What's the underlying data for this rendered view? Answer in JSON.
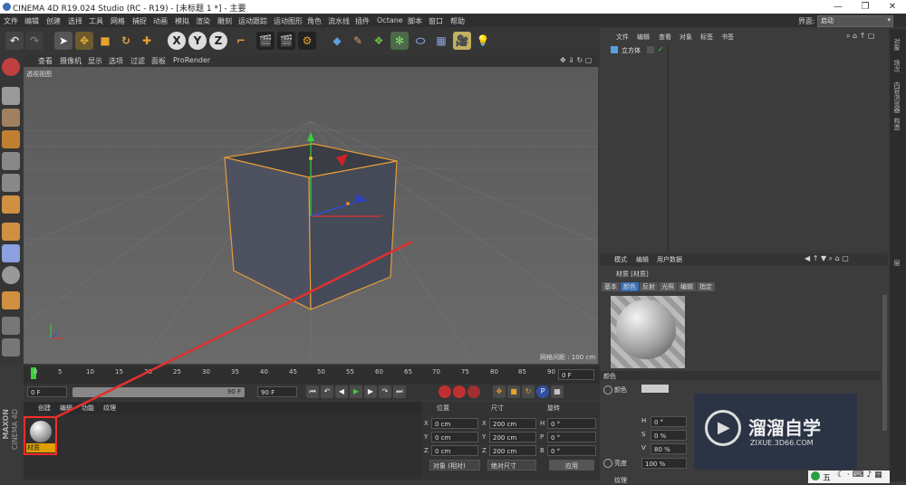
{
  "titlebar": {
    "title": "CINEMA 4D R19.024 Studio (RC - R19) - [未标题 1 *] - 主要",
    "min": "—",
    "max": "❐",
    "close": "✕"
  },
  "menu": [
    "文件",
    "编辑",
    "创建",
    "选择",
    "工具",
    "网格",
    "捕捉",
    "动画",
    "模拟",
    "渲染",
    "雕刻",
    "运动跟踪",
    "运动图形",
    "角色",
    "流水线",
    "插件",
    "Octane",
    "脚本",
    "窗口",
    "帮助"
  ],
  "interface": {
    "label": "界面:",
    "value": "启动"
  },
  "toolbar": {
    "x": "X",
    "y": "Y",
    "z": "Z"
  },
  "viewport": {
    "menu": [
      "查看",
      "摄像机",
      "显示",
      "选项",
      "过滤",
      "面板",
      "ProRender"
    ],
    "label": "透视视图",
    "grid_info": "网格间距 : 100 cm"
  },
  "timeline": {
    "ticks": [
      "0",
      "5",
      "10",
      "15",
      "20",
      "25",
      "30",
      "35",
      "40",
      "45",
      "50",
      "55",
      "60",
      "65",
      "70",
      "75",
      "80",
      "85",
      "90"
    ],
    "frame": "0 F"
  },
  "controls": {
    "start": "0 F",
    "range": "90 F",
    "end": "90 F"
  },
  "material_manager": {
    "tabs": [
      "创建",
      "编辑",
      "功能",
      "纹理"
    ],
    "material_name": "材质",
    "logo1": "MAXON",
    "logo2": "CINEMA 4D"
  },
  "coordinates": {
    "headers": [
      "位置",
      "尺寸",
      "旋转"
    ],
    "rows": [
      {
        "a": "X",
        "pos": "0 cm",
        "b": "X",
        "size": "200 cm",
        "c": "H",
        "rot": "0 °"
      },
      {
        "a": "Y",
        "pos": "0 cm",
        "b": "Y",
        "size": "200 cm",
        "c": "P",
        "rot": "0 °"
      },
      {
        "a": "Z",
        "pos": "0 cm",
        "b": "Z",
        "size": "200 cm",
        "c": "B",
        "rot": "0 °"
      }
    ],
    "mode1": "对象 (相对)",
    "mode2": "绝对尺寸",
    "apply": "应用"
  },
  "object_manager": {
    "menu": [
      "文件",
      "编辑",
      "查看",
      "对象",
      "标签",
      "书签"
    ],
    "object": "立方体"
  },
  "attributes": {
    "menu": [
      "模式",
      "编辑",
      "用户数据"
    ],
    "title": "材质 [材质]",
    "tabs": [
      "基本",
      "颜色",
      "反射",
      "光照",
      "编辑",
      "指定"
    ],
    "section": "颜色",
    "color_label": "颜色",
    "h_label": "H",
    "h_value": "0 °",
    "s_label": "S",
    "s_value": "0 %",
    "v_label": "V",
    "v_value": "80 %",
    "brightness_label": "亮度",
    "brightness_value": "100 %",
    "texture_label": "纹理"
  },
  "right_tabs": [
    "对象",
    "场次",
    "内容浏览器",
    "构造",
    "层"
  ],
  "watermark": {
    "brand": "溜溜自学",
    "url": "ZIXUE.3D66.COM"
  },
  "ime": {
    "label": "五"
  },
  "colors": {
    "accent": "#e0a000",
    "cube_edge": "#e69b3c",
    "red_line": "#e03030",
    "highlight_box": "#ff2a2a"
  }
}
